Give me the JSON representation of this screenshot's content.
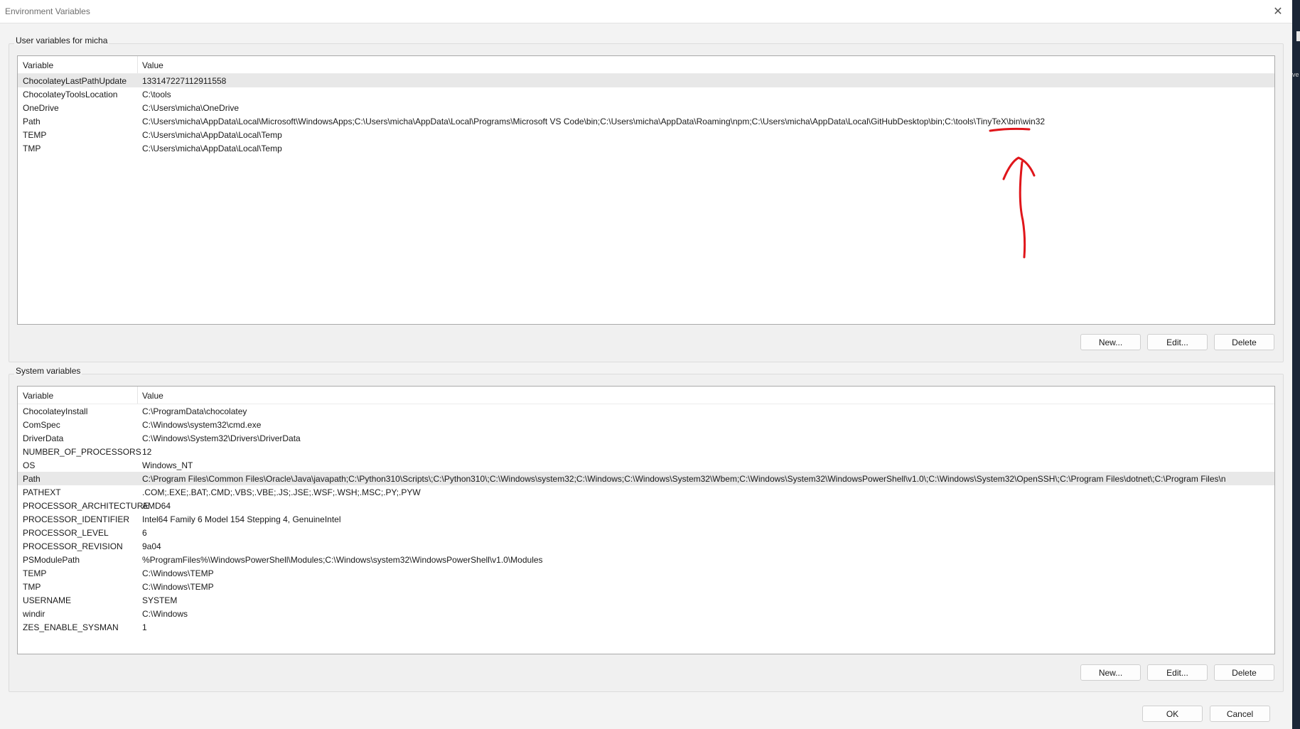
{
  "window": {
    "title": "Environment Variables",
    "close_label": "✕"
  },
  "user_section": {
    "label": "User variables for micha",
    "columns": {
      "variable": "Variable",
      "value": "Value"
    },
    "rows": [
      {
        "variable": "ChocolateyLastPathUpdate",
        "value": "133147227112911558"
      },
      {
        "variable": "ChocolateyToolsLocation",
        "value": "C:\\tools"
      },
      {
        "variable": "OneDrive",
        "value": "C:\\Users\\micha\\OneDrive"
      },
      {
        "variable": "Path",
        "value": "C:\\Users\\micha\\AppData\\Local\\Microsoft\\WindowsApps;C:\\Users\\micha\\AppData\\Local\\Programs\\Microsoft VS Code\\bin;C:\\Users\\micha\\AppData\\Roaming\\npm;C:\\Users\\micha\\AppData\\Local\\GitHubDesktop\\bin;C:\\tools\\TinyTeX\\bin\\win32"
      },
      {
        "variable": "TEMP",
        "value": "C:\\Users\\micha\\AppData\\Local\\Temp"
      },
      {
        "variable": "TMP",
        "value": "C:\\Users\\micha\\AppData\\Local\\Temp"
      }
    ],
    "selected_row": 0,
    "buttons": {
      "new": "New...",
      "edit": "Edit...",
      "delete": "Delete"
    }
  },
  "system_section": {
    "label": "System variables",
    "columns": {
      "variable": "Variable",
      "value": "Value"
    },
    "rows": [
      {
        "variable": "ChocolateyInstall",
        "value": "C:\\ProgramData\\chocolatey"
      },
      {
        "variable": "ComSpec",
        "value": "C:\\Windows\\system32\\cmd.exe"
      },
      {
        "variable": "DriverData",
        "value": "C:\\Windows\\System32\\Drivers\\DriverData"
      },
      {
        "variable": "NUMBER_OF_PROCESSORS",
        "value": "12"
      },
      {
        "variable": "OS",
        "value": "Windows_NT"
      },
      {
        "variable": "Path",
        "value": "C:\\Program Files\\Common Files\\Oracle\\Java\\javapath;C:\\Python310\\Scripts\\;C:\\Python310\\;C:\\Windows\\system32;C:\\Windows;C:\\Windows\\System32\\Wbem;C:\\Windows\\System32\\WindowsPowerShell\\v1.0\\;C:\\Windows\\System32\\OpenSSH\\;C:\\Program Files\\dotnet\\;C:\\Program Files\\n"
      },
      {
        "variable": "PATHEXT",
        "value": ".COM;.EXE;.BAT;.CMD;.VBS;.VBE;.JS;.JSE;.WSF;.WSH;.MSC;.PY;.PYW"
      },
      {
        "variable": "PROCESSOR_ARCHITECTURE",
        "value": "AMD64"
      },
      {
        "variable": "PROCESSOR_IDENTIFIER",
        "value": "Intel64 Family 6 Model 154 Stepping 4, GenuineIntel"
      },
      {
        "variable": "PROCESSOR_LEVEL",
        "value": "6"
      },
      {
        "variable": "PROCESSOR_REVISION",
        "value": "9a04"
      },
      {
        "variable": "PSModulePath",
        "value": "%ProgramFiles%\\WindowsPowerShell\\Modules;C:\\Windows\\system32\\WindowsPowerShell\\v1.0\\Modules"
      },
      {
        "variable": "TEMP",
        "value": "C:\\Windows\\TEMP"
      },
      {
        "variable": "TMP",
        "value": "C:\\Windows\\TEMP"
      },
      {
        "variable": "USERNAME",
        "value": "SYSTEM"
      },
      {
        "variable": "windir",
        "value": "C:\\Windows"
      },
      {
        "variable": "ZES_ENABLE_SYSMAN",
        "value": "1"
      }
    ],
    "selected_row": 5,
    "buttons": {
      "new": "New...",
      "edit": "Edit...",
      "delete": "Delete"
    }
  },
  "footer": {
    "ok": "OK",
    "cancel": "Cancel"
  },
  "annotation": {
    "color": "#e0161b"
  },
  "background_window": {
    "text": "ve"
  }
}
